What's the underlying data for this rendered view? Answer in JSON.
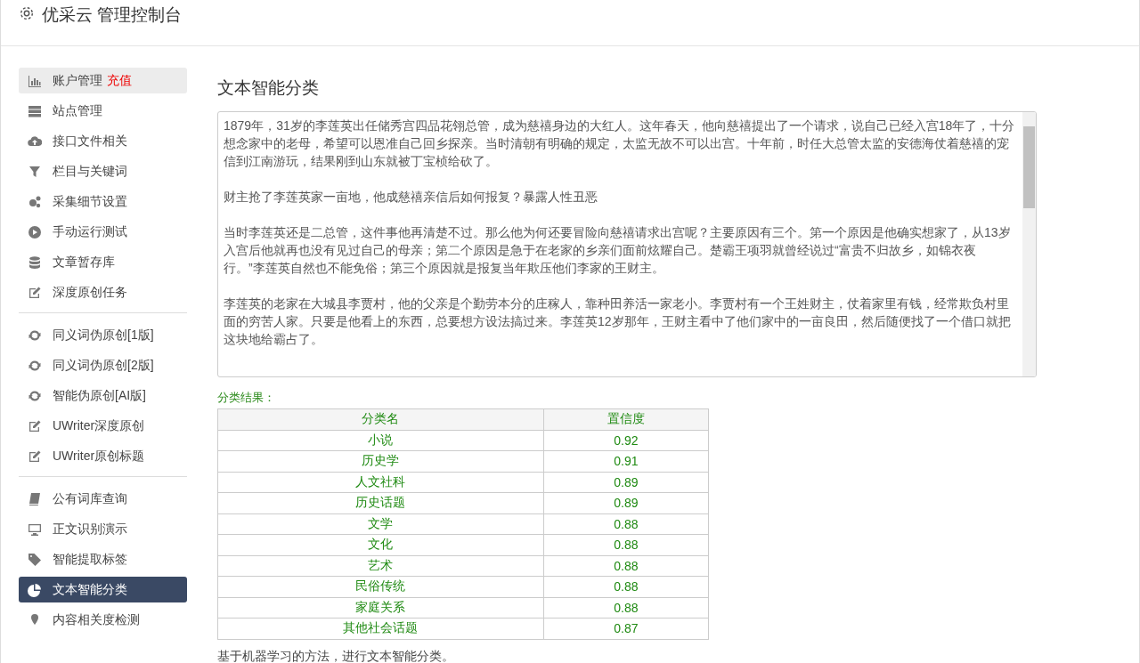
{
  "header": {
    "title": "优采云 管理控制台"
  },
  "sidebar": {
    "groups": [
      [
        {
          "label": "账户管理",
          "badge": "充值",
          "hovered": true,
          "selected": false
        },
        {
          "label": "站点管理",
          "hovered": false,
          "selected": false
        },
        {
          "label": "接口文件相关",
          "hovered": false,
          "selected": false
        },
        {
          "label": "栏目与关键词",
          "hovered": false,
          "selected": false
        },
        {
          "label": "采集细节设置",
          "hovered": false,
          "selected": false
        },
        {
          "label": "手动运行测试",
          "hovered": false,
          "selected": false
        },
        {
          "label": "文章暂存库",
          "hovered": false,
          "selected": false
        },
        {
          "label": "深度原创任务",
          "hovered": false,
          "selected": false
        }
      ],
      [
        {
          "label": "同义词伪原创[1版]",
          "hovered": false,
          "selected": false
        },
        {
          "label": "同义词伪原创[2版]",
          "hovered": false,
          "selected": false
        },
        {
          "label": "智能伪原创[AI版]",
          "hovered": false,
          "selected": false
        },
        {
          "label": "UWriter深度原创",
          "hovered": false,
          "selected": false
        },
        {
          "label": "UWriter原创标题",
          "hovered": false,
          "selected": false
        }
      ],
      [
        {
          "label": "公有词库查询",
          "hovered": false,
          "selected": false
        },
        {
          "label": "正文识别演示",
          "hovered": false,
          "selected": false
        },
        {
          "label": "智能提取标签",
          "hovered": false,
          "selected": false
        },
        {
          "label": "文本智能分类",
          "hovered": false,
          "selected": true
        },
        {
          "label": "内容相关度检测",
          "hovered": false,
          "selected": false
        }
      ]
    ]
  },
  "page": {
    "heading": "文本智能分类",
    "input_text": [
      "1879年，31岁的李莲英出任储秀宫四品花翎总管，成为慈禧身边的大红人。这年春天，他向慈禧提出了一个请求，说自己已经入宫18年了，十分想念家中的老母，希望可以恩准自己回乡探亲。当时清朝有明确的规定，太监无故不可以出宫。十年前，时任大总管太监的安德海仗着慈禧的宠信到江南游玩，结果刚到山东就被丁宝桢给砍了。",
      "财主抢了李莲英家一亩地，他成慈禧亲信后如何报复？暴露人性丑恶",
      "当时李莲英还是二总管，这件事他再清楚不过。那么他为何还要冒险向慈禧请求出宫呢？主要原因有三个。第一个原因是他确实想家了，从13岁入宫后他就再也没有见过自己的母亲；第二个原因是急于在老家的乡亲们面前炫耀自己。楚霸王项羽就曾经说过“富贵不归故乡，如锦衣夜行。”李莲英自然也不能免俗；第三个原因就是报复当年欺压他们李家的王财主。",
      "李莲英的老家在大城县李贾村，他的父亲是个勤劳本分的庄稼人，靠种田养活一家老小。李贾村有一个王姓财主，仗着家里有钱，经常欺负村里面的穷苦人家。只要是他看上的东西，总要想方设法搞过来。李莲英12岁那年，王财主看中了他们家中的一亩良田，然后随便找了一个借口就把这块地给霸占了。"
    ],
    "result_label": "分类结果：",
    "table": {
      "columns": [
        "分类名",
        "置信度"
      ],
      "rows": [
        {
          "name": "小说",
          "score": "0.92"
        },
        {
          "name": "历史学",
          "score": "0.91"
        },
        {
          "name": "人文社科",
          "score": "0.89"
        },
        {
          "name": "历史话题",
          "score": "0.89"
        },
        {
          "name": "文学",
          "score": "0.88"
        },
        {
          "name": "文化",
          "score": "0.88"
        },
        {
          "name": "艺术",
          "score": "0.88"
        },
        {
          "name": "民俗传统",
          "score": "0.88"
        },
        {
          "name": "家庭关系",
          "score": "0.88"
        },
        {
          "name": "其他社会话题",
          "score": "0.87"
        }
      ]
    },
    "note": "基于机器学习的方法，进行文本智能分类。"
  }
}
